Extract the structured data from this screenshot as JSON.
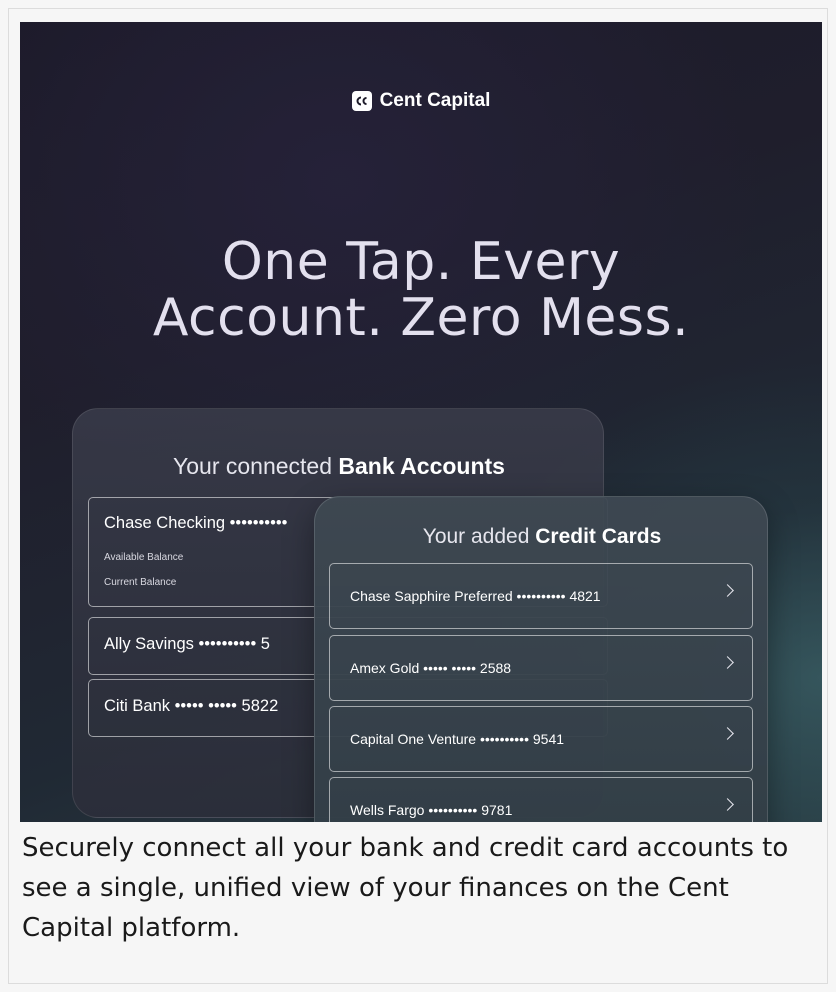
{
  "brand": {
    "name": "Cent Capital",
    "logo_icon": "cent-capital-logo-icon"
  },
  "hero": {
    "headline_line1": "One Tap. Every",
    "headline_line2": "Account. Zero Mess."
  },
  "bank_accounts": {
    "title_prefix": "Your connected ",
    "title_bold": "Bank Accounts",
    "items": [
      {
        "label": "Chase Checking ••••••••••",
        "available_label": "Available Balance",
        "current_label": "Current Balance"
      },
      {
        "label": "Ally Savings  •••••••••• 5"
      },
      {
        "label": "Citi Bank  ••••• ••••• 5822"
      }
    ]
  },
  "credit_cards": {
    "title_prefix": "Your added ",
    "title_bold": "Credit Cards",
    "items": [
      {
        "label": "Chase Sapphire Preferred  •••••••••• 4821"
      },
      {
        "label": "Amex Gold  ••••• ••••• 2588"
      },
      {
        "label": "Capital One Venture  •••••••••• 9541"
      },
      {
        "label": "Wells Fargo  •••••••••• 9781"
      }
    ]
  },
  "caption": "Securely connect all your bank and credit card accounts to see a single, unified view of your finances on the Cent Capital platform."
}
